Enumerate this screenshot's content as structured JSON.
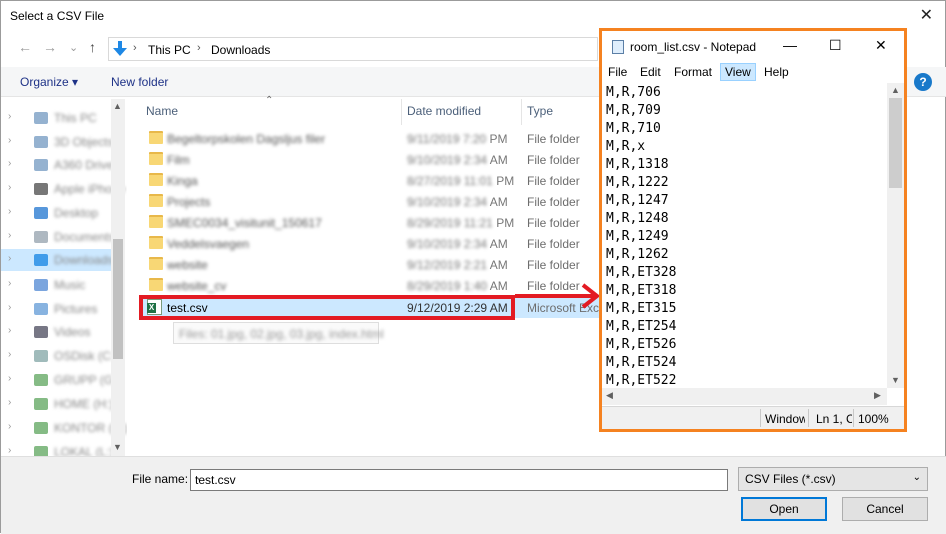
{
  "dialog": {
    "title": "Select a CSV File",
    "close_glyph": "✕"
  },
  "nav": {
    "back_glyph": "←",
    "forward_glyph": "→",
    "recent_glyph": "⌄",
    "up_glyph": "↑",
    "address": {
      "root": "This PC",
      "folder": "Downloads",
      "sep": "›"
    }
  },
  "toolbar": {
    "organize": "Organize ▾",
    "new_folder": "New folder",
    "help": "?"
  },
  "sidebar": {
    "items": [
      {
        "label": "This PC",
        "chev": "›"
      },
      {
        "label": "3D Objects",
        "chev": "›"
      },
      {
        "label": "A360 Drive",
        "chev": "›"
      },
      {
        "label": "Apple iPhone",
        "chev": "›"
      },
      {
        "label": "Desktop",
        "chev": "›"
      },
      {
        "label": "Documents",
        "chev": "›"
      },
      {
        "label": "Downloads",
        "chev": "›"
      },
      {
        "label": "Music",
        "chev": "›"
      },
      {
        "label": "Pictures",
        "chev": "›"
      },
      {
        "label": "Videos",
        "chev": "›"
      },
      {
        "label": "OSDisk (C:)",
        "chev": "›"
      },
      {
        "label": "GRUPP (G:)",
        "chev": "›"
      },
      {
        "label": "HOME (H:)",
        "chev": "›"
      },
      {
        "label": "KONTOR (K:)",
        "chev": "›"
      },
      {
        "label": "LOKAL (L:)",
        "chev": "›"
      }
    ]
  },
  "file_list": {
    "columns": {
      "name": "Name",
      "date": "Date modified",
      "type": "Type",
      "sort_glyph": "⌃"
    },
    "rows": [
      {
        "name": "Begeltorpskolen Dagsljus filer",
        "date_blur": "9/11/2019 7:20",
        "date_suffix": " PM",
        "type": "File folder"
      },
      {
        "name": "Film",
        "date_blur": "9/10/2019 2:34",
        "date_suffix": " AM",
        "type": "File folder"
      },
      {
        "name": "Kinga",
        "date_blur": "8/27/2019 11:01",
        "date_suffix": " PM",
        "type": "File folder"
      },
      {
        "name": "Projects",
        "date_blur": "9/10/2019 2:34",
        "date_suffix": " AM",
        "type": "File folder"
      },
      {
        "name": "SMEC0034_visitunit_150617",
        "date_blur": "8/29/2019 11:21",
        "date_suffix": " PM",
        "type": "File folder"
      },
      {
        "name": "Veddelsvaegen",
        "date_blur": "9/10/2019 2:34",
        "date_suffix": " AM",
        "type": "File folder"
      },
      {
        "name": "website",
        "date_blur": "9/12/2019 2:21",
        "date_suffix": " AM",
        "type": "File folder"
      },
      {
        "name": "website_cv",
        "date_blur": "8/29/2019 1:40",
        "date_suffix": " AM",
        "type": "File folder"
      }
    ],
    "selected": {
      "name": "test.csv",
      "date": "9/12/2019 2:29 AM",
      "type": "Microsoft Exce",
      "icon_letter": "X"
    },
    "tooltip": "Files: 01.jpg, 02.jpg, 03.jpg, index.html"
  },
  "footer": {
    "file_name_label": "File name:",
    "file_name_value": "test.csv",
    "filter_value": "CSV Files (*.csv)",
    "dd_glyph": "⌄",
    "open": "Open",
    "cancel": "Cancel"
  },
  "notepad": {
    "title": "room_list.csv - Notepad",
    "min_glyph": "—",
    "max_glyph": "☐",
    "close_glyph": "✕",
    "menu": [
      "File",
      "Edit",
      "Format",
      "View",
      "Help"
    ],
    "lines": [
      "M,R,706",
      "M,R,709",
      "M,R,710",
      "M,R,x",
      "M,R,1318",
      "M,R,1222",
      "M,R,1247",
      "M,R,1248",
      "M,R,1249",
      "M,R,1262",
      "M,R,ET328",
      "M,R,ET318",
      "M,R,ET315",
      "M,R,ET254",
      "M,R,ET526",
      "M,R,ET524",
      "M,R,ET522"
    ],
    "status": {
      "encoding": "Windows",
      "position": "Ln 1, C",
      "zoom": "100%"
    },
    "scroll": {
      "up": "▲",
      "down": "▼",
      "left": "◀",
      "right": "▶"
    }
  },
  "colors": {
    "highlight_box": "#e31b23",
    "notepad_border": "#f58220",
    "selection": "#cce8ff"
  }
}
